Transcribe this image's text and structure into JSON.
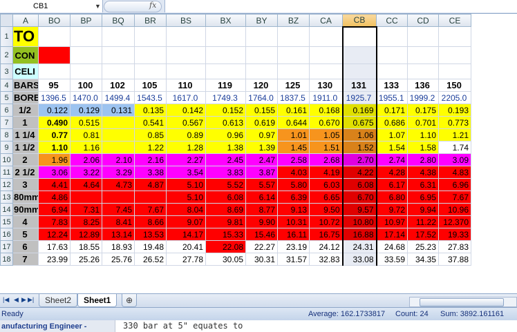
{
  "formula_bar": {
    "name_box": "CB1",
    "fx_icon": "fx",
    "formula": ""
  },
  "columns": [
    "A",
    "BO",
    "BP",
    "BQ",
    "BR",
    "BS",
    "BX",
    "BY",
    "BZ",
    "CA",
    "CB",
    "CC",
    "CD",
    "CE"
  ],
  "selected_column": "CB",
  "rows": [
    {
      "n": "1",
      "cells": [
        "TO",
        "",
        "",
        "",
        "",
        "",
        "",
        "",
        "",
        "",
        "",
        "",
        "",
        ""
      ]
    },
    {
      "n": "2",
      "cells": [
        "CON",
        "",
        "",
        "",
        "",
        "",
        "",
        "",
        "",
        "",
        "",
        "",
        "",
        ""
      ]
    },
    {
      "n": "3",
      "cells": [
        "CELI",
        "",
        "",
        "",
        "",
        "",
        "",
        "",
        "",
        "",
        "",
        "",
        "",
        ""
      ]
    },
    {
      "n": "4",
      "cells": [
        "BARS",
        "95",
        "100",
        "102",
        "105",
        "110",
        "119",
        "120",
        "125",
        "130",
        "131",
        "133",
        "136",
        "150"
      ]
    },
    {
      "n": "5",
      "cells": [
        "BORE",
        "1396.5",
        "1470.0",
        "1499.4",
        "1543.5",
        "1617.0",
        "1749.3",
        "1764.0",
        "1837.5",
        "1911.0",
        "1925.7",
        "1955.1",
        "1999.2",
        "2205.0"
      ]
    },
    {
      "n": "6",
      "cells": [
        "1/2",
        "0.122",
        "0.129",
        "0.131",
        "0.135",
        "0.142",
        "0.152",
        "0.155",
        "0.161",
        "0.168",
        "0.169",
        "0.171",
        "0.175",
        "0.193"
      ]
    },
    {
      "n": "7",
      "cells": [
        "1",
        "0.490",
        "0.515",
        "",
        "0.541",
        "0.567",
        "0.613",
        "0.619",
        "0.644",
        "0.670",
        "0.675",
        "0.686",
        "0.701",
        "0.773"
      ]
    },
    {
      "n": "8",
      "cells": [
        "1 1/4",
        "0.77",
        "0.81",
        "",
        "0.85",
        "0.89",
        "0.96",
        "0.97",
        "1.01",
        "1.05",
        "1.06",
        "1.07",
        "1.10",
        "1.21"
      ]
    },
    {
      "n": "9",
      "cells": [
        "1 1/2",
        "1.10",
        "1.16",
        "",
        "1.22",
        "1.28",
        "1.38",
        "1.39",
        "1.45",
        "1.51",
        "1.52",
        "1.54",
        "1.58",
        "1.74"
      ]
    },
    {
      "n": "10",
      "cells": [
        "2",
        "1.96",
        "2.06",
        "2.10",
        "2.16",
        "2.27",
        "2.45",
        "2.47",
        "2.58",
        "2.68",
        "2.70",
        "2.74",
        "2.80",
        "3.09"
      ]
    },
    {
      "n": "11",
      "cells": [
        "2 1/2",
        "3.06",
        "3.22",
        "3.29",
        "3.38",
        "3.54",
        "3.83",
        "3.87",
        "4.03",
        "4.19",
        "4.22",
        "4.28",
        "4.38",
        "4.83"
      ]
    },
    {
      "n": "12",
      "cells": [
        "3",
        "4.41",
        "4.64",
        "4.73",
        "4.87",
        "5.10",
        "5.52",
        "5.57",
        "5.80",
        "6.03",
        "6.08",
        "6.17",
        "6.31",
        "6.96"
      ]
    },
    {
      "n": "13",
      "cells": [
        "80mm",
        "4.86",
        "",
        "",
        "",
        "5.10",
        "6.08",
        "6.14",
        "6.39",
        "6.65",
        "6.70",
        "6.80",
        "6.95",
        "7.67"
      ]
    },
    {
      "n": "14",
      "cells": [
        "90mm",
        "6.94",
        "7.31",
        "7.45",
        "7.67",
        "8.04",
        "8.69",
        "8.77",
        "9.13",
        "9.50",
        "9.57",
        "9.72",
        "9.94",
        "10.96"
      ]
    },
    {
      "n": "15",
      "cells": [
        "4",
        "7.83",
        "8.25",
        "8.41",
        "8.66",
        "9.07",
        "9.81",
        "9.90",
        "10.31",
        "10.72",
        "10.80",
        "10.97",
        "11.22",
        "12.370"
      ]
    },
    {
      "n": "16",
      "cells": [
        "5",
        "12.24",
        "12.89",
        "13.14",
        "13.53",
        "14.17",
        "15.33",
        "15.46",
        "16.11",
        "16.75",
        "16.88",
        "17.14",
        "17.52",
        "19.33"
      ]
    },
    {
      "n": "17",
      "cells": [
        "6",
        "17.63",
        "18.55",
        "18.93",
        "19.48",
        "20.41",
        "22.08",
        "22.27",
        "23.19",
        "24.12",
        "24.31",
        "24.68",
        "25.23",
        "27.83"
      ]
    },
    {
      "n": "18",
      "cells": [
        "7",
        "23.99",
        "25.26",
        "25.76",
        "26.52",
        "27.78",
        "30.05",
        "30.31",
        "31.57",
        "32.83",
        "33.08",
        "33.59",
        "34.35",
        "37.88"
      ]
    }
  ],
  "colors": {
    "yellow": "#ffff00",
    "orange": "#f7941d",
    "magenta": "#ff00ff",
    "red": "#ff0000",
    "light_blue": "#9cc3f0",
    "olive": "#93c021",
    "pale_cyan": "#ccffff",
    "gray": "#c0c0c0",
    "header_bg": "#dde4ee",
    "selected_header": "#f4c86a"
  },
  "sheet_tabs": [
    {
      "label": "Sheet2",
      "active": false
    },
    {
      "label": "Sheet1",
      "active": true
    }
  ],
  "status": {
    "ready": "Ready",
    "average": "Average: 162.1733817",
    "count": "Count: 24",
    "sum": "Sum: 3892.161161"
  },
  "bottom": {
    "left_text": "anufacturing Engineer -",
    "main_text": "330 bar at  5\"  equates to"
  }
}
